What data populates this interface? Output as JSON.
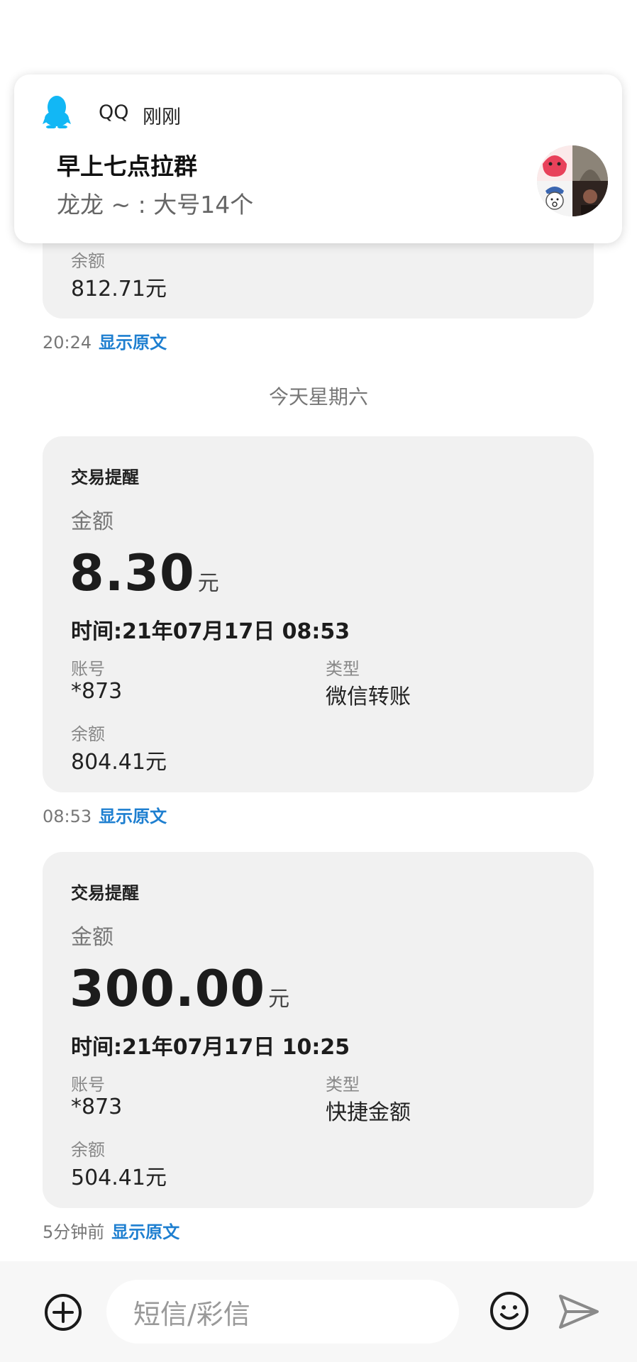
{
  "notification": {
    "app": "QQ",
    "time": "刚刚",
    "title": "早上七点拉群",
    "body": "龙龙 ~ : 大号14个"
  },
  "messages": [
    {
      "balance_label": "余额",
      "balance": "812.71元",
      "timestamp": "20:24",
      "show_original": "显示原文"
    },
    {
      "title": "交易提醒",
      "amount_label": "金额",
      "amount": "8.30",
      "amount_unit": "元",
      "time_line": "时间:21年07月17日 08:53",
      "account_label": "账号",
      "account": "*873",
      "type_label": "类型",
      "type": "微信转账",
      "balance_label": "余额",
      "balance": "804.41元",
      "timestamp": "08:53",
      "show_original": "显示原文"
    },
    {
      "title": "交易提醒",
      "amount_label": "金额",
      "amount": "300.00",
      "amount_unit": "元",
      "time_line": "时间:21年07月17日 10:25",
      "account_label": "账号",
      "account": "*873",
      "type_label": "类型",
      "type": "快捷金额",
      "balance_label": "余额",
      "balance": "504.41元",
      "timestamp": "5分钟前",
      "show_original": "显示原文"
    }
  ],
  "day_separator": "今天星期六",
  "input": {
    "placeholder": "短信/彩信"
  },
  "colors": {
    "link": "#1e7fd0",
    "card_bg": "#f1f1f1",
    "qq_icon": "#12b7f5"
  },
  "icons": {
    "app": "qq-penguin-icon",
    "add": "plus-circle-icon",
    "emoji": "smiley-icon",
    "send": "send-arrow-icon"
  }
}
